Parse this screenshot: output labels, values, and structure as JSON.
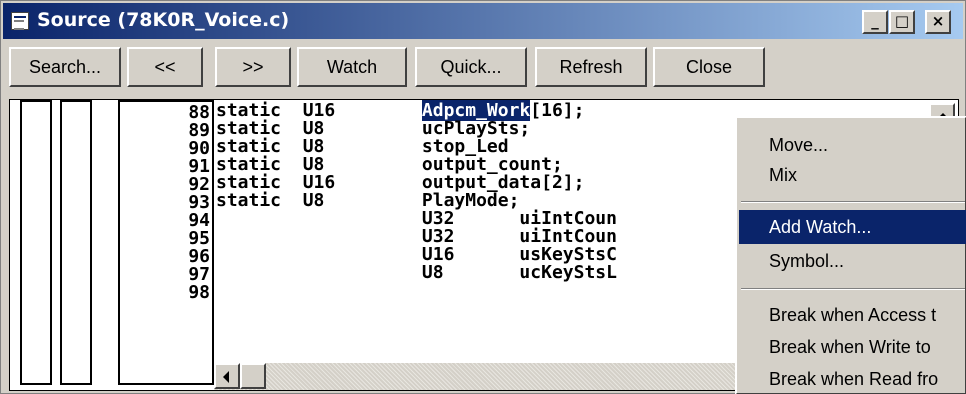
{
  "window": {
    "title": "Source (78K0R_Voice.c)",
    "title_controls": {
      "minimize": "_",
      "maximize": "□",
      "close": "×"
    }
  },
  "toolbar": {
    "buttons": [
      "Search...",
      "<<",
      ">>",
      "Watch",
      "Quick...",
      "Refresh",
      "Close"
    ]
  },
  "source": {
    "line_numbers": [
      "88",
      "89",
      "90",
      "91",
      "92",
      "93",
      "94",
      "95",
      "96",
      "97",
      "98"
    ],
    "lines": [
      {
        "pre": "static  U16        ",
        "sel": "Adpcm_Work",
        "post": "[16];"
      },
      {
        "pre": "static  U8         ucPlaySts;",
        "sel": "",
        "post": ""
      },
      {
        "pre": "static  U8         stop_Led",
        "sel": "",
        "post": ""
      },
      {
        "pre": "static  U8         output_count;",
        "sel": "",
        "post": ""
      },
      {
        "pre": "static  U16        output_data[2];",
        "sel": "",
        "post": ""
      },
      {
        "pre": "static  U8         PlayMode;",
        "sel": "",
        "post": ""
      },
      {
        "pre": "                   U32      uiIntCoun",
        "sel": "",
        "post": ""
      },
      {
        "pre": "                   U32      uiIntCoun",
        "sel": "",
        "post": ""
      },
      {
        "pre": "                   U16      usKeyStsC",
        "sel": "",
        "post": ""
      },
      {
        "pre": "                   U8       ucKeyStsL",
        "sel": "",
        "post": ""
      },
      {
        "pre": "",
        "sel": "",
        "post": ""
      }
    ]
  },
  "context_menu": {
    "items": [
      "Move...",
      "Mix",
      "Add Watch...",
      "Symbol...",
      "Break when Access t",
      "Break when Write to",
      "Break when Read fro"
    ],
    "highlighted": "Add Watch..."
  },
  "colors": {
    "selection": "#0a246a",
    "face": "#d4d0c8"
  }
}
